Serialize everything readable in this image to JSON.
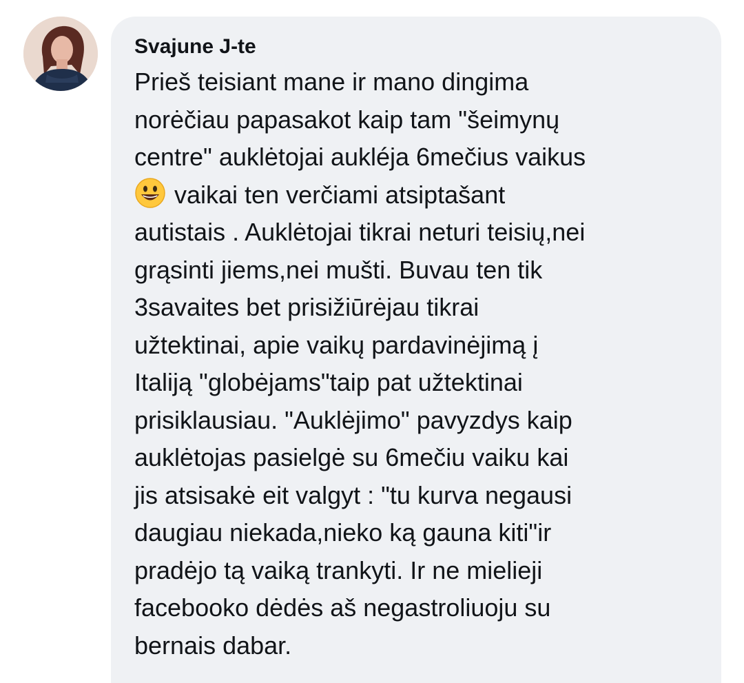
{
  "comment": {
    "author": "Svajune J-te",
    "emoji_icon": "grinning-face-emoji",
    "lines": [
      "Prieš teisiant mane ir mano dingima",
      "norėčiau papasakot kaip tam \"šeimynų",
      "centre\" auklėtojai aukléja 6mečius vaikus",
      "vaikai ten verčiami atsiptašant",
      "autistais . Auklėtojai tikrai neturi teisių,nei",
      "grąsinti jiems,nei mušti. Buvau ten tik",
      "3savaites bet prisižiūrėjau tikrai",
      "užtektinai, apie vaikų pardavinėjimą į",
      "Italiją \"globėjams\"taip pat užtektinai",
      "prisiklausiau. \"Auklėjimo\" pavyzdys kaip",
      "auklėtojas pasielgė su 6mečiu vaiku kai",
      "jis atsisakė eit valgyt : \"tu kurva negausi",
      "daugiau niekada,nieko ką gauna kiti\"ir",
      "pradėjo tą vaiką trankyti. Ir ne mielieji",
      "facebooko dėdės aš negastroliuoju su",
      "bernais dabar."
    ]
  },
  "colors": {
    "bubble_background": "#eff1f4",
    "text": "#111418",
    "emoji_face": "#ffc83d"
  }
}
